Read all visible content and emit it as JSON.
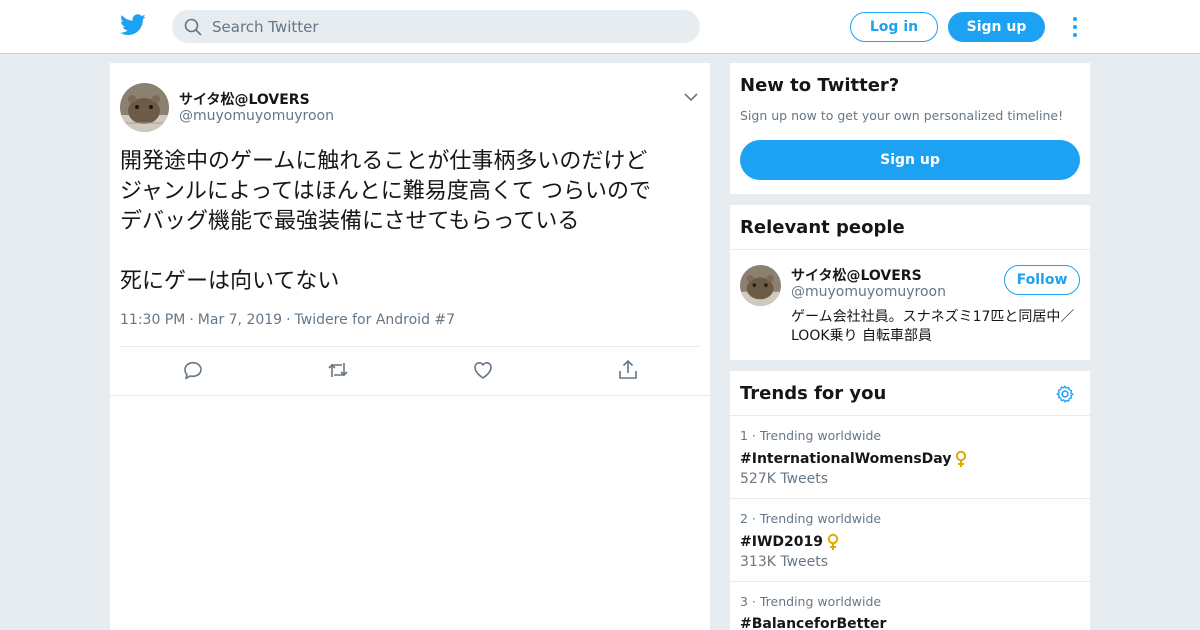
{
  "colors": {
    "brand": "#1da1f2",
    "secondary_text": "#657786",
    "page_bg": "#e6ecf0"
  },
  "header": {
    "logo_icon": "twitter-bird-icon",
    "search": {
      "placeholder": "Search Twitter"
    },
    "login_label": "Log in",
    "signup_label": "Sign up",
    "more_icon": "vertical-ellipsis-icon"
  },
  "tweet": {
    "author_name": "サイタ松@LOVERS",
    "author_handle": "@muyomuyomuyroon",
    "text": "開発途中のゲームに触れることが仕事柄多いのだけど\nジャンルによってはほんとに難易度高くて つらいので\nデバッグ機能で最強装備にさせてもらっている\n\n死にゲーは向いてない",
    "time": "11:30 PM",
    "date": "Mar 7, 2019",
    "source": "Twidere for Android #7",
    "separator": "·"
  },
  "new_to_twitter": {
    "title": "New to Twitter?",
    "subtitle": "Sign up now to get your own personalized timeline!",
    "signup_label": "Sign up"
  },
  "relevant_people": {
    "title": "Relevant people",
    "person": {
      "name": "サイタ松@LOVERS",
      "handle": "@muyomuyomuyroon",
      "bio": "ゲーム会社社員。スナネズミ17匹と同居中／LOOK乗り 自転車部員",
      "follow_label": "Follow"
    }
  },
  "trends": {
    "title": "Trends for you",
    "items": [
      {
        "rank": "1",
        "context": "Trending worldwide",
        "name": "#InternationalWomensDay",
        "count": "527K Tweets",
        "emoji": "venus-icon"
      },
      {
        "rank": "2",
        "context": "Trending worldwide",
        "name": "#IWD2019",
        "count": "313K Tweets",
        "emoji": "venus-icon"
      },
      {
        "rank": "3",
        "context": "Trending worldwide",
        "name": "#BalanceforBetter",
        "count": "",
        "emoji": ""
      }
    ]
  }
}
